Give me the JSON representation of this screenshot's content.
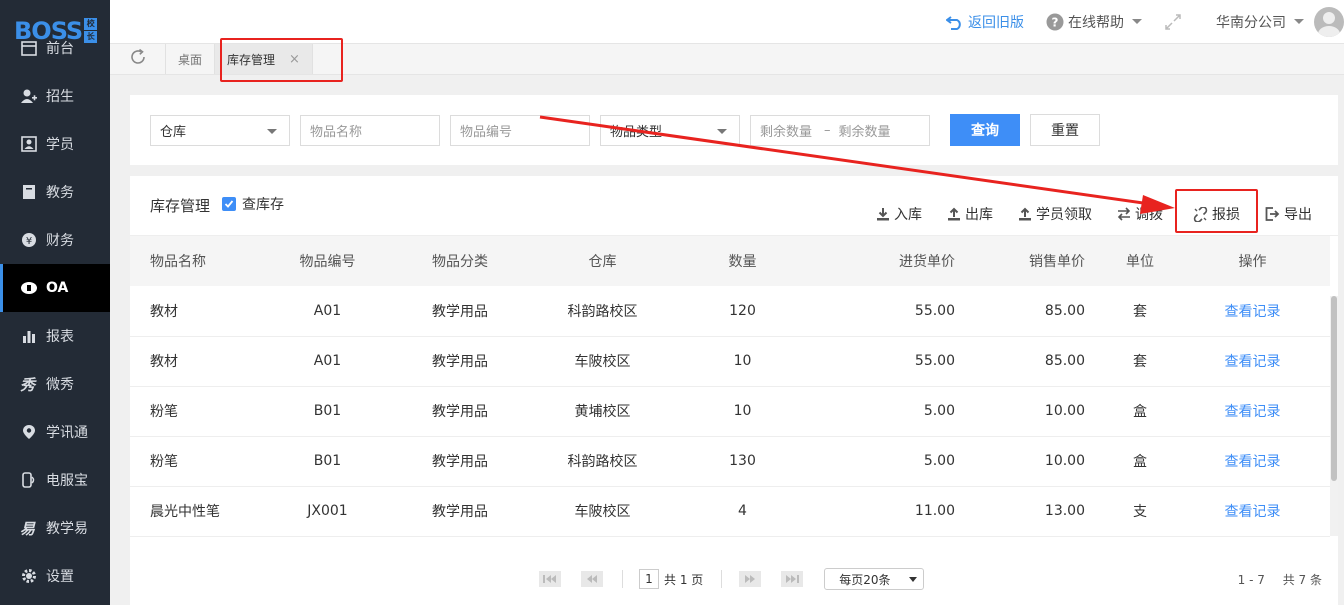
{
  "sidebar": {
    "logo_text": "BOSS",
    "logo_badge": [
      "校",
      "长"
    ],
    "items": [
      {
        "label": "前台",
        "icon": "calendar-icon"
      },
      {
        "label": "招生",
        "icon": "add-user-icon"
      },
      {
        "label": "学员",
        "icon": "student-card-icon"
      },
      {
        "label": "教务",
        "icon": "book-icon"
      },
      {
        "label": "财务",
        "icon": "yen-icon"
      },
      {
        "label": "OA",
        "icon": "oa-icon",
        "active": true
      },
      {
        "label": "报表",
        "icon": "bar-chart-icon"
      },
      {
        "label": "微秀",
        "icon": "weixiu-icon"
      },
      {
        "label": "学讯通",
        "icon": "location-icon"
      },
      {
        "label": "电服宝",
        "icon": "phone-icon"
      },
      {
        "label": "教学易",
        "icon": "teach-icon"
      },
      {
        "label": "设置",
        "icon": "gear-icon"
      }
    ]
  },
  "header": {
    "back_label": "返回旧版",
    "help_label": "在线帮助",
    "branch_label": "华南分公司"
  },
  "tabs": {
    "items": [
      {
        "label": "桌面"
      },
      {
        "label": "库存管理",
        "active": true,
        "close": "×"
      }
    ]
  },
  "filter": {
    "warehouse_value": "仓库",
    "item_name_placeholder": "物品名称",
    "item_code_placeholder": "物品编号",
    "item_type_value": "物品类型",
    "qty_min_placeholder": "剩余数量",
    "qty_sep": "–",
    "qty_max_placeholder": "剩余数量",
    "search_label": "查询",
    "reset_label": "重置"
  },
  "panel": {
    "title": "库存管理",
    "checkbox_label": "查库存",
    "actions": [
      {
        "label": "入库",
        "icon": "download-icon"
      },
      {
        "label": "出库",
        "icon": "upload-icon"
      },
      {
        "label": "学员领取",
        "icon": "upload-icon"
      },
      {
        "label": "调拨",
        "icon": "transfer-icon"
      },
      {
        "label": "报损",
        "icon": "broken-link-icon"
      },
      {
        "label": "导出",
        "icon": "export-icon"
      }
    ]
  },
  "table": {
    "columns": [
      "物品名称",
      "物品编号",
      "物品分类",
      "仓库",
      "数量",
      "进货单价",
      "销售单价",
      "单位",
      "操作"
    ],
    "rows": [
      {
        "name": "教材",
        "code": "A01",
        "category": "教学用品",
        "warehouse": "科韵路校区",
        "qty": "120",
        "buy_price": "55.00",
        "sell_price": "85.00",
        "unit": "套",
        "op": "查看记录"
      },
      {
        "name": "教材",
        "code": "A01",
        "category": "教学用品",
        "warehouse": "车陂校区",
        "qty": "10",
        "buy_price": "55.00",
        "sell_price": "85.00",
        "unit": "套",
        "op": "查看记录"
      },
      {
        "name": "粉笔",
        "code": "B01",
        "category": "教学用品",
        "warehouse": "黄埔校区",
        "qty": "10",
        "buy_price": "5.00",
        "sell_price": "10.00",
        "unit": "盒",
        "op": "查看记录"
      },
      {
        "name": "粉笔",
        "code": "B01",
        "category": "教学用品",
        "warehouse": "科韵路校区",
        "qty": "130",
        "buy_price": "5.00",
        "sell_price": "10.00",
        "unit": "盒",
        "op": "查看记录"
      },
      {
        "name": "晨光中性笔",
        "code": "JX001",
        "category": "教学用品",
        "warehouse": "车陂校区",
        "qty": "4",
        "buy_price": "11.00",
        "sell_price": "13.00",
        "unit": "支",
        "op": "查看记录"
      }
    ]
  },
  "pager": {
    "page": "1",
    "total_pages_label": "共 1 页",
    "page_size_label": "每页20条",
    "range_label": "1 - 7",
    "total_label": "共 7 条"
  },
  "colors": {
    "accent": "#3e8ef7",
    "sidebar_bg": "#232b36",
    "annotation_red": "#e8231f"
  }
}
